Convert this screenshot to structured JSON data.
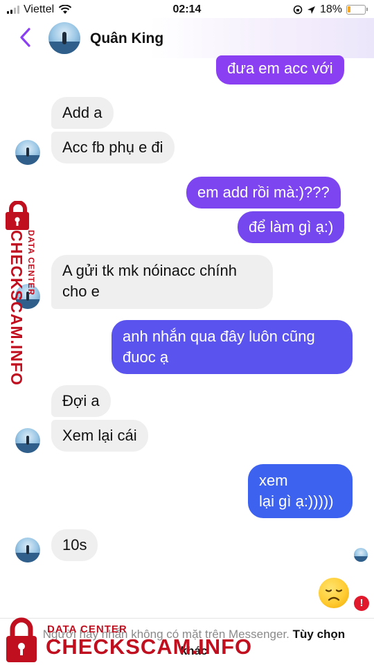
{
  "status_bar": {
    "carrier": "Viettel",
    "time": "02:14",
    "battery": "18%",
    "battery_level": 0.18
  },
  "header": {
    "contact_name": "Quân King"
  },
  "messages": [
    {
      "side": "out",
      "text": "đưa em acc với"
    },
    {
      "side": "in",
      "text": "Add a"
    },
    {
      "side": "in",
      "text": "Acc fb phụ e đi"
    },
    {
      "side": "out",
      "text": "em add rồi mà:)???"
    },
    {
      "side": "out",
      "text": "để làm gì ạ:)"
    },
    {
      "side": "in",
      "lines": [
        "A gửi tk mk nóinacc chính",
        "cho e"
      ]
    },
    {
      "side": "out",
      "lines": [
        "anh nhắn qua đây luôn cũng",
        "đuoc ạ"
      ]
    },
    {
      "side": "in",
      "text": "Đợi a"
    },
    {
      "side": "in",
      "text": "Xem lại cái"
    },
    {
      "side": "out",
      "lines": [
        "xem",
        "lại gì ạ:)))))"
      ]
    },
    {
      "side": "in",
      "text": "10s"
    }
  ],
  "footer": {
    "notice": "Người hay nhắn không có mặt trên Messenger.",
    "action": "Tùy chọn khác"
  },
  "watermark": {
    "top_label": "DATA CENTER",
    "brand": "CHECKSCAM.INFO"
  },
  "colors": {
    "accent": "#8a3ff2",
    "out_bubble_top": "#8a3ff2",
    "out_bubble_bottom": "#3d62f0",
    "in_bubble": "#efefef",
    "watermark": "#c01020",
    "alert": "#e0192d"
  },
  "icons": {
    "back": "chevron-left-icon",
    "wifi": "wifi-icon",
    "location": "location-arrow-icon",
    "rotation_lock": "rotation-lock-icon",
    "reaction": "disappointed-face-icon",
    "error": "exclamation-icon",
    "lock": "lock-icon"
  }
}
